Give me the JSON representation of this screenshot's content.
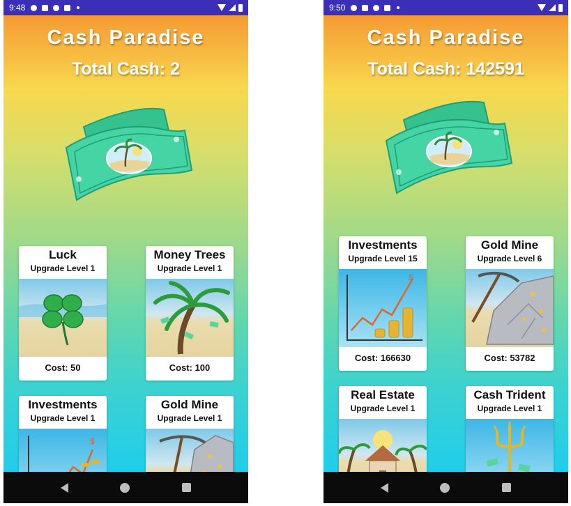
{
  "screens": [
    {
      "status": {
        "time": "9:48"
      },
      "title": "Cash Paradise",
      "total_cash_text": "Total Cash: 2",
      "cards": [
        {
          "name": "Luck",
          "level": "Upgrade Level 1",
          "cost": "Cost: 50",
          "art": "clover"
        },
        {
          "name": "Money Trees",
          "level": "Upgrade Level 1",
          "cost": "Cost: 100",
          "art": "palm"
        },
        {
          "name": "Investments",
          "level": "Upgrade Level 1",
          "cost": "",
          "art": "chart"
        },
        {
          "name": "Gold Mine",
          "level": "Upgrade Level 1",
          "cost": "",
          "art": "mine"
        }
      ]
    },
    {
      "status": {
        "time": "9:50"
      },
      "title": "Cash Paradise",
      "total_cash_text": "Total Cash: 142591",
      "cards": [
        {
          "name": "Investments",
          "level": "Upgrade Level 15",
          "cost": "Cost: 166630",
          "art": "chart"
        },
        {
          "name": "Gold Mine",
          "level": "Upgrade Level 6",
          "cost": "Cost: 53782",
          "art": "mine"
        },
        {
          "name": "Real Estate",
          "level": "Upgrade Level 1",
          "cost": "",
          "art": "house"
        },
        {
          "name": "Cash Trident",
          "level": "Upgrade Level 1",
          "cost": "",
          "art": "trident"
        }
      ]
    }
  ],
  "colors": {
    "statusbar": "#3b2fb8",
    "navbar": "#0b0b0b",
    "bill": "#3fcf9f"
  }
}
